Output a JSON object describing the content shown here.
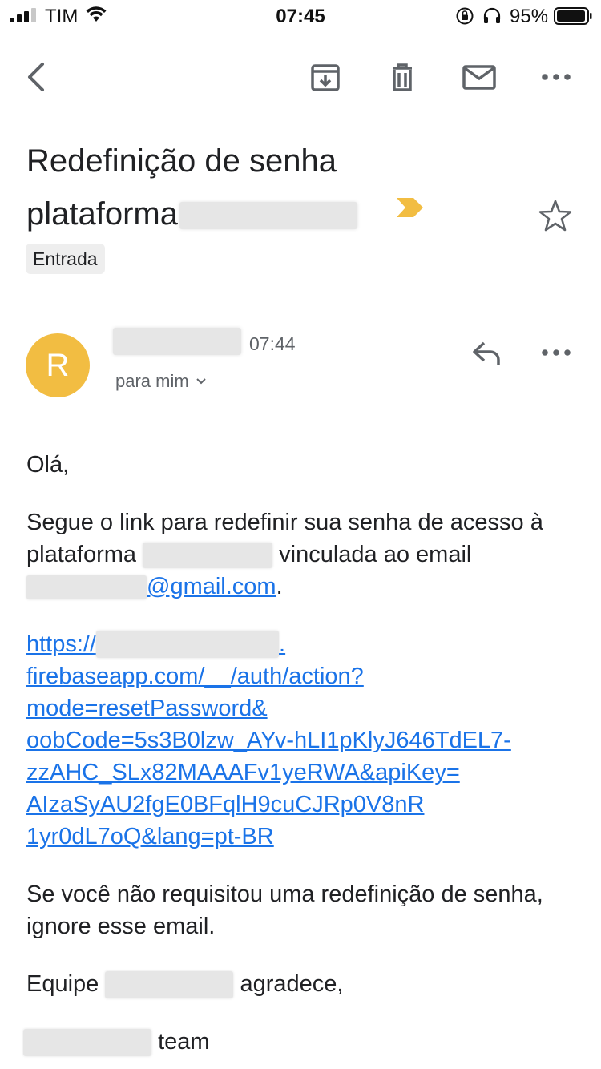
{
  "status_bar": {
    "carrier": "TIM",
    "time": "07:45",
    "battery_percent": "95%"
  },
  "toolbar": {
    "icons": [
      "back-icon",
      "archive-icon",
      "trash-icon",
      "mail-icon",
      "more-icon"
    ]
  },
  "email": {
    "subject_line1": "Redefinição de senha",
    "subject_line2": "plataforma",
    "label": "Entrada",
    "sender_initial": "R",
    "time": "07:44",
    "recipients": "para mim",
    "greeting": "Olá,",
    "para1_part1": "Segue o link para redefinir sua senha de acesso à plataforma",
    "para1_part2": "vinculada ao email",
    "email_link_suffix": "@gmail.com",
    "para1_end": ".",
    "link_lines": [
      "https://",
      "firebaseapp.com/__/auth/action?",
      "mode=resetPassword&",
      "oobCode=5s3B0lzw_AYv-hLI1pKlyJ646TdEL7-",
      "zzAHC_SLx82MAAAFv1yeRWA&apiKey=",
      "AIzaSyAU2fgE0BFqlH9cuCJRp0V8nR",
      "1yr0dL7oQ&lang=pt-BR"
    ],
    "link_line1_tail": ".",
    "para3": "Se você não requisitou uma redefinição de senha, ignore esse email.",
    "sign_prefix": "Equipe",
    "sign_suffix": "agradece,",
    "team_suffix": "team"
  },
  "colors": {
    "avatar": "#f2bd42",
    "link": "#1a73e8",
    "important_marker": "#f2bd42"
  }
}
